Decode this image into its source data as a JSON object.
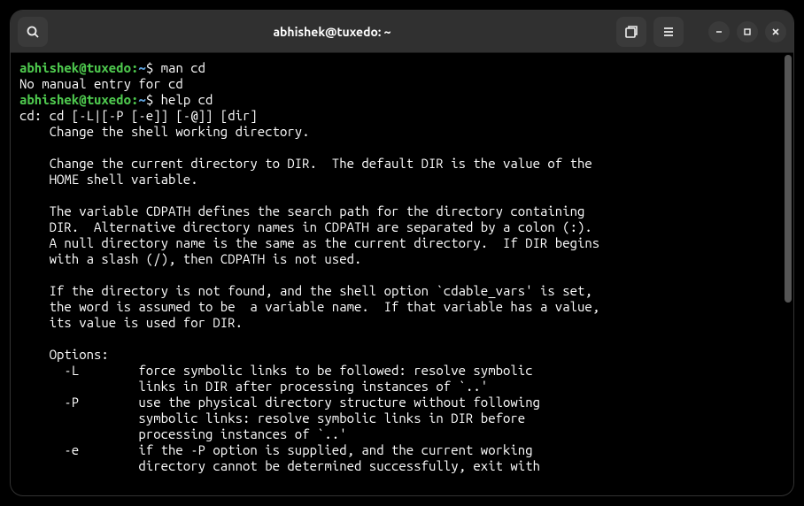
{
  "titlebar": {
    "title": "abhishek@tuxedo: ~"
  },
  "prompt": {
    "userHost": "abhishek@tuxedo",
    "path": "~",
    "symbol": "$"
  },
  "lines": {
    "cmd1": "man cd",
    "out1": "No manual entry for cd",
    "cmd2": "help cd",
    "help": [
      "cd: cd [-L|[-P [-e]] [-@]] [dir]",
      "    Change the shell working directory.",
      "    ",
      "    Change the current directory to DIR.  The default DIR is the value of the",
      "    HOME shell variable.",
      "    ",
      "    The variable CDPATH defines the search path for the directory containing",
      "    DIR.  Alternative directory names in CDPATH are separated by a colon (:).",
      "    A null directory name is the same as the current directory.  If DIR begins",
      "    with a slash (/), then CDPATH is not used.",
      "    ",
      "    If the directory is not found, and the shell option `cdable_vars' is set,",
      "    the word is assumed to be  a variable name.  If that variable has a value,",
      "    its value is used for DIR.",
      "    ",
      "    Options:",
      "      -L        force symbolic links to be followed: resolve symbolic",
      "                links in DIR after processing instances of `..'",
      "      -P        use the physical directory structure without following",
      "                symbolic links: resolve symbolic links in DIR before",
      "                processing instances of `..'",
      "      -e        if the -P option is supplied, and the current working",
      "                directory cannot be determined successfully, exit with"
    ]
  }
}
